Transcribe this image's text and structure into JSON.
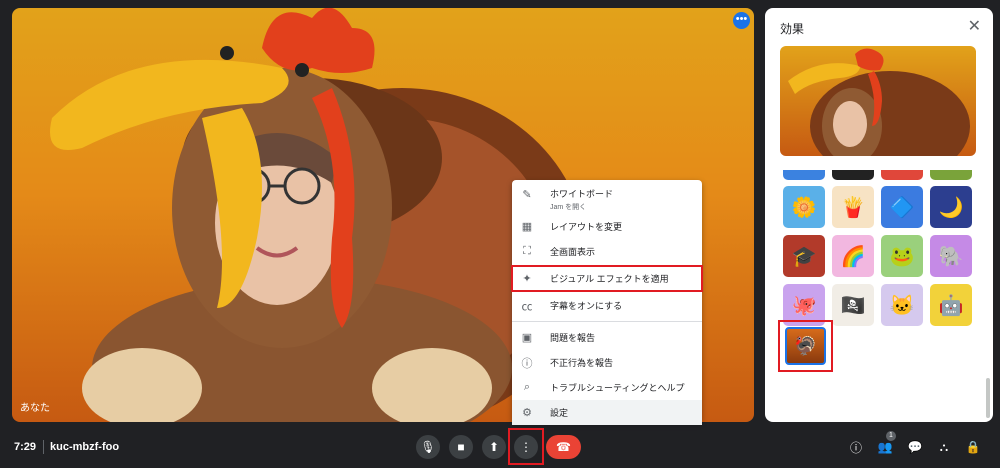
{
  "video": {
    "self_label": "あなた",
    "more_icon": "more-horiz-icon"
  },
  "menu": {
    "items": [
      {
        "label": "ホワイトボード",
        "sub": "Jam を開く",
        "icon": "pen-icon"
      },
      {
        "label": "レイアウトを変更",
        "icon": "layout-icon"
      },
      {
        "label": "全画面表示",
        "icon": "fullscreen-icon"
      },
      {
        "label": "ビジュアル エフェクトを適用",
        "icon": "sparkle-icon"
      },
      {
        "label": "字幕をオンにする",
        "icon": "captions-icon"
      },
      {
        "label": "問題を報告",
        "icon": "feedback-icon"
      },
      {
        "label": "不正行為を報告",
        "icon": "alert-icon"
      },
      {
        "label": "トラブルシューティングとヘルプ",
        "icon": "troubleshoot-icon"
      },
      {
        "label": "設定",
        "icon": "settings-icon"
      }
    ]
  },
  "panel": {
    "title": "効果",
    "close_icon": "close-icon",
    "effects": [
      {
        "name": "daisy",
        "glyph": "🌼",
        "bg": "#5ab0e8"
      },
      {
        "name": "fries",
        "glyph": "🍟",
        "bg": "#f7e3c4"
      },
      {
        "name": "glass-block",
        "glyph": "🔷",
        "bg": "#3b7be0"
      },
      {
        "name": "moon-sleep",
        "glyph": "🌙",
        "bg": "#2c3e8f"
      },
      {
        "name": "graduation-cap",
        "glyph": "🎓",
        "bg": "#b23a2a"
      },
      {
        "name": "rainbow-heart",
        "glyph": "🌈",
        "bg": "#f2b7e0"
      },
      {
        "name": "frog",
        "glyph": "🐸",
        "bg": "#9ad07c"
      },
      {
        "name": "purple-elephant",
        "glyph": "🐘",
        "bg": "#c58ae6"
      },
      {
        "name": "purple-octopus",
        "glyph": "🐙",
        "bg": "#c9a3ee"
      },
      {
        "name": "pirate",
        "glyph": "🏴‍☠️",
        "bg": "#f1ede6"
      },
      {
        "name": "white-cat",
        "glyph": "🐱",
        "bg": "#d5c9ee"
      },
      {
        "name": "robot",
        "glyph": "🤖",
        "bg": "#f2d23a"
      }
    ],
    "selected_effect": {
      "name": "turkey",
      "glyph": "🦃"
    }
  },
  "bottom": {
    "time": "7:29",
    "meeting_code": "kuc-mbzf-foo",
    "participant_count": "1"
  },
  "colors": {
    "highlight": "#e11b22",
    "end_call": "#ea4335",
    "accent": "#1a73e8"
  }
}
